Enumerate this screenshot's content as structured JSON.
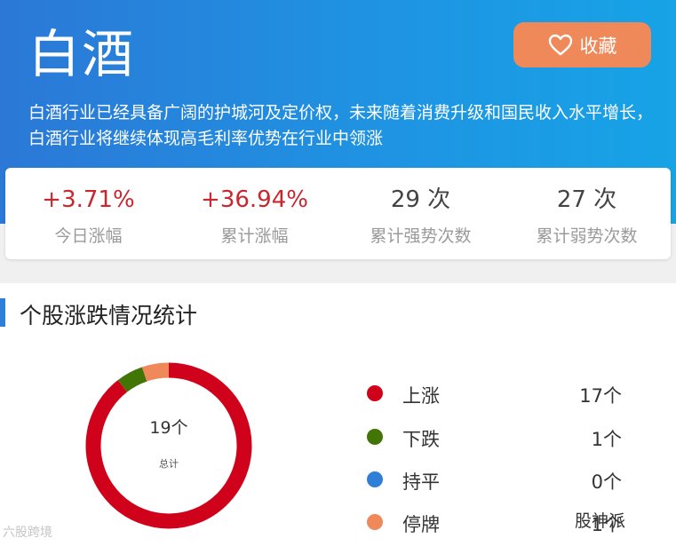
{
  "header": {
    "title": "白酒",
    "favorite_label": "收藏",
    "description": "白酒行业已经具备广阔的护城河及定价权，未来随着消费升级和国民收入水平增长，白酒行业将继续体现高毛利率优势在行业中领涨"
  },
  "stats": [
    {
      "value": "+3.71%",
      "label": "今日涨幅"
    },
    {
      "value": "+36.94%",
      "label": "累计涨幅"
    },
    {
      "value": "29 次",
      "label": "累计强势次数"
    },
    {
      "value": "27 次",
      "label": "累计弱势次数"
    }
  ],
  "section": {
    "title": "个股涨跌情况统计",
    "total_label": "19个",
    "total_sub": "总计"
  },
  "breakdown": [
    {
      "label": "上涨",
      "count": "17个",
      "value": 17,
      "color": "#d0021b"
    },
    {
      "label": "下跌",
      "count": "1个",
      "value": 1,
      "color": "#417505"
    },
    {
      "label": "持平",
      "count": "0个",
      "value": 0,
      "color": "#2f7fd8"
    },
    {
      "label": "停牌",
      "count": "1个",
      "value": 1,
      "color": "#f0895a"
    }
  ],
  "colors": {
    "header_gradient_start": "#2b78d6",
    "header_gradient_end": "#17a3e6",
    "accent_orange": "#f0895a",
    "up_red": "#c9262e"
  },
  "watermarks": {
    "left": "六股跨境",
    "right": "股神派"
  }
}
